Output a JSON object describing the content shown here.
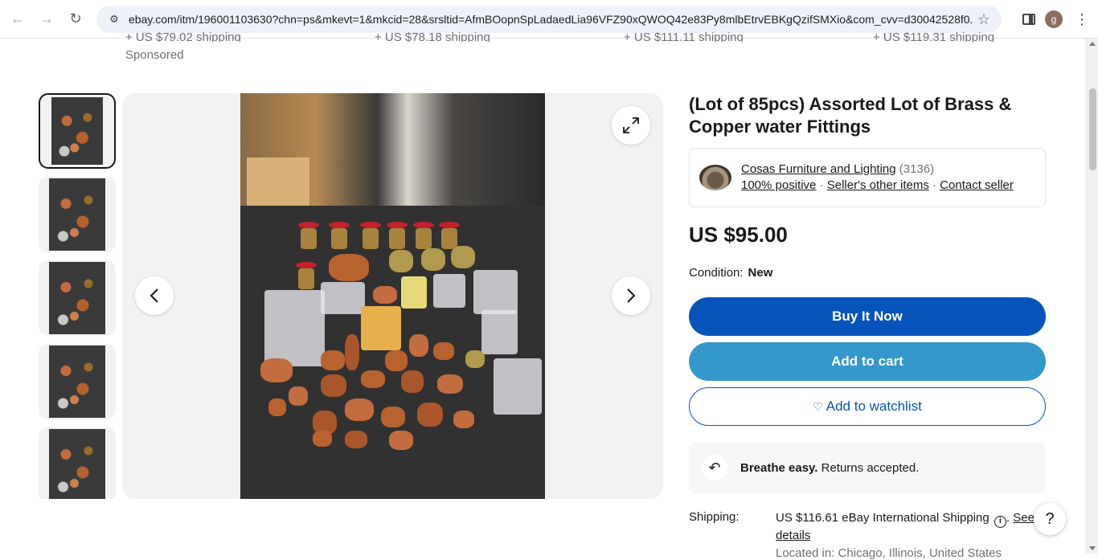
{
  "browser": {
    "url": "ebay.com/itm/196001103630?chn=ps&mkevt=1&mkcid=28&srsltid=AfmBOopnSpLadaedLia96VFZ90xQWOQ42e83Py8mlbEtrvEBKgQzifSMXio&com_cvv=d30042528f0...",
    "profile_initial": "g"
  },
  "top_strip": {
    "shipping_items": [
      "+ US $79.02 shipping",
      "+ US $78.18 shipping",
      "+ US $111.11 shipping",
      "+ US $119.31 shipping"
    ],
    "sponsored": "Sponsored"
  },
  "listing": {
    "title": "(Lot of 85pcs) Assorted Lot of Brass & Copper water Fittings",
    "seller": {
      "name": "Cosas Furniture and Lighting",
      "feedback_count": "(3136)",
      "positive": "100% positive",
      "other_items": "Seller's other items",
      "contact": "Contact seller",
      "separator": "·"
    },
    "price": "US $95.00",
    "condition_label": "Condition:",
    "condition_value": "New",
    "buy_now": "Buy It Now",
    "add_to_cart": "Add to cart",
    "add_to_watchlist": "Add to watchlist",
    "returns_bold": "Breathe easy.",
    "returns_text": "Returns accepted.",
    "shipping_label": "Shipping:",
    "shipping_value": "US $116.61 eBay International Shipping",
    "see_details": "See details",
    "location": "Located in: Chicago, Illinois, United States"
  },
  "help": "?",
  "colors": {
    "buy_now": "#0654ba",
    "add_to_cart": "#3498ca",
    "text": "#191919"
  }
}
